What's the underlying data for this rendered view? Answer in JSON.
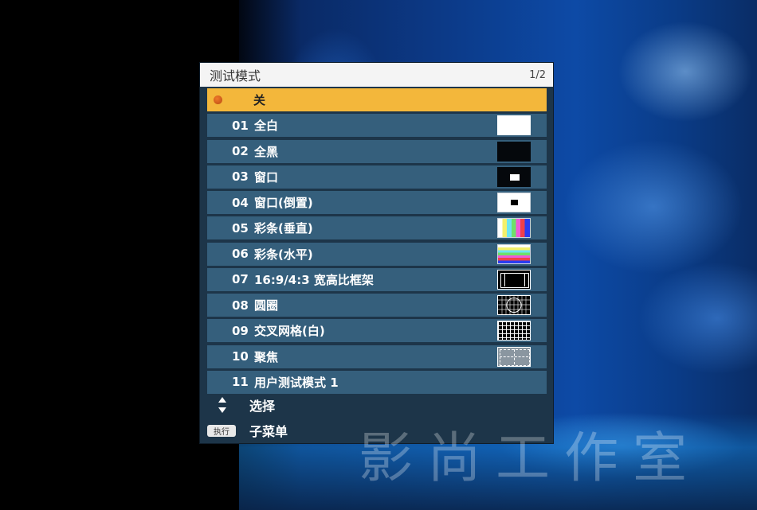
{
  "menu": {
    "title": "测试模式",
    "page": "1/2",
    "items": [
      {
        "num": "",
        "label": "关",
        "thumb": "off-dot",
        "selected": true
      },
      {
        "num": "01",
        "label": "全白",
        "thumb": "full-white"
      },
      {
        "num": "02",
        "label": "全黑",
        "thumb": "full-black"
      },
      {
        "num": "03",
        "label": "窗口",
        "thumb": "window"
      },
      {
        "num": "04",
        "label": "窗口(倒置)",
        "thumb": "window-inverted"
      },
      {
        "num": "05",
        "label": "彩条(垂直)",
        "thumb": "color-bars-vertical"
      },
      {
        "num": "06",
        "label": "彩条(水平)",
        "thumb": "color-bars-horizontal"
      },
      {
        "num": "07",
        "label": "16:9/4:3 宽高比框架",
        "thumb": "aspect-frame"
      },
      {
        "num": "08",
        "label": "圆圈",
        "thumb": "circle"
      },
      {
        "num": "09",
        "label": "交叉网格(白)",
        "thumb": "crosshatch-white"
      },
      {
        "num": "10",
        "label": "聚焦",
        "thumb": "focus"
      },
      {
        "num": "11",
        "label": "用户测试模式 1",
        "thumb": ""
      }
    ]
  },
  "footer": {
    "select_label": "选择",
    "exec_key": "执行",
    "submenu_label": "子菜单"
  },
  "watermark": "影尚工作室",
  "colors": {
    "header_bg": "#f4f4f4",
    "menu_bg": "#1d3549",
    "row_bg": "#355f7c",
    "selected_row_bg": "#f3b73b"
  }
}
